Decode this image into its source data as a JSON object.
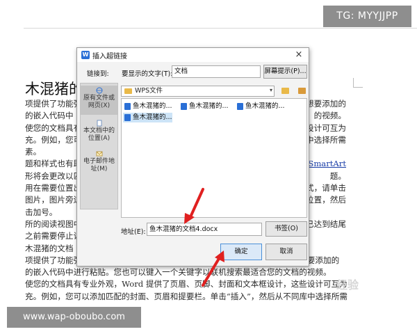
{
  "watermarks": {
    "top": "TG: MYYJJPP",
    "bottom": "www.wap-oboubo.com",
    "logo": "经验"
  },
  "document": {
    "heading": "木混猪的",
    "lines": [
      {
        "left": "项提供了功能强",
        "right": "想要添加的"
      },
      {
        "left": "的嵌入代码中",
        "right": "的视频。"
      },
      {
        "left": "使您的文档具有",
        "right": "设计可互为"
      },
      {
        "left": "充。例如，您可",
        "right": "中选择所需"
      },
      {
        "left": "素。",
        "right": ""
      },
      {
        "left": "题和样式也有助",
        "right": "SmartArt",
        "right_link": true
      },
      {
        "left": "形将会更改以匹",
        "right": "题。"
      },
      {
        "left": "用在需要位置出",
        "right": "式，请单击"
      },
      {
        "left": "图片，图片旁边",
        "right": "位置，然后"
      },
      {
        "left": "击加号。",
        "right": ""
      },
      {
        "left": "所的阅读视图中",
        "right": "已达到结尾"
      },
      {
        "left": "之前需要停止读",
        "right": ""
      },
      {
        "left": "木混猪的文档",
        "right": ""
      },
      {
        "left": "项提供了功能强大的方法帮助您证明您的观点。当您单击联机视频时，可以在想要添加的",
        "right": ""
      },
      {
        "left": "的嵌入代码中进行粘贴。您也可以键入一个关键字以联机搜索最适合您的文档的视频。",
        "right": ""
      },
      {
        "left": "使您的文档具有专业外观，Word 提供了页眉、页脚、封面和文本框设计，这些设计可互为",
        "right": ""
      },
      {
        "left": "充。例如，您可以添加匹配的封面、页眉和提要栏。单击“插入”，然后从不同库中选择所需",
        "right": ""
      }
    ]
  },
  "dialog": {
    "title": "插入超链接",
    "close_symbol": "×",
    "link_to_label": "链接到:",
    "display_text_label": "要显示的文字(T):",
    "display_text_value": "文档",
    "screentip_button": "屏幕提示(P)...",
    "sidebar": [
      {
        "label": "原有文件或网页(X)",
        "icon": "globe-icon",
        "active": true
      },
      {
        "label": "本文档中的位置(A)",
        "icon": "bookmark-icon",
        "active": false
      },
      {
        "label": "电子邮件地址(M)",
        "icon": "mail-icon",
        "active": false
      }
    ],
    "folder": "WPS文件",
    "files": [
      "鱼木混猪的...",
      "鱼木混猪的...",
      "鱼木混猪的...",
      "鱼木混猪的..."
    ],
    "address_label": "地址(E):",
    "address_value": "鱼木混猪的文档4.docx",
    "bookmark_button": "书签(O)",
    "ok_button": "确定",
    "cancel_button": "取消"
  },
  "colors": {
    "arrow": "#e02020",
    "accent": "#2a6fd6",
    "selection": "#cde4f7"
  }
}
